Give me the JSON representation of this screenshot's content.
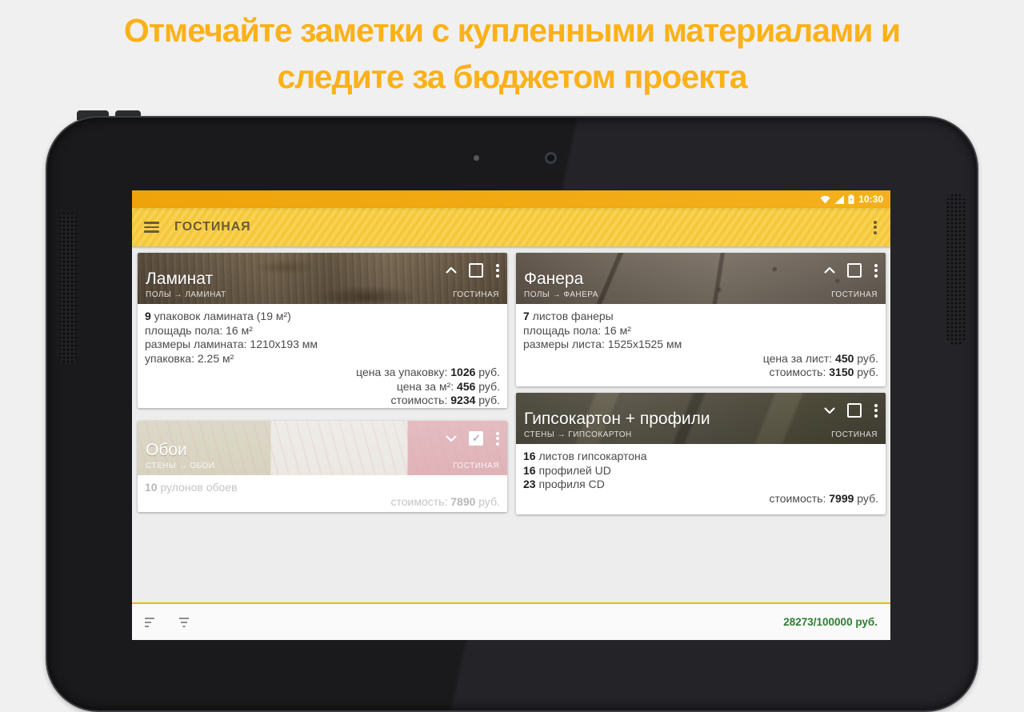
{
  "headline": {
    "line1": "Отмечайте заметки с купленными материалами и",
    "line2": "следите за бюджетом проекта"
  },
  "colors": {
    "headline_amber": "#FBB118",
    "status_bar_orange": "#F2A90F",
    "toolbar_yellow": "#F6CC45",
    "budget_green": "#2E7D32",
    "content_gray": "#EDEDED"
  },
  "status_bar": {
    "time": "10:30",
    "icons": [
      "wifi-icon",
      "cellular-signal-icon",
      "battery-icon"
    ]
  },
  "toolbar": {
    "title": "ГОСТИНАЯ",
    "menu_icon": "hamburger-menu-icon",
    "overflow_icon": "overflow-menu-icon"
  },
  "cards": [
    {
      "title": "Ламинат",
      "breadcrumb": "ПОЛЫ → ЛАМИНАТ",
      "room": "ГОСТИНАЯ",
      "chevron": "up",
      "checked": false,
      "left_lines": [
        {
          "pre": "",
          "b": "9",
          "post": " упаковок ламината (19 м²)"
        },
        {
          "pre": "площадь пола: 16 м²",
          "b": "",
          "post": ""
        },
        {
          "pre": "размеры ламината: 1210x193 мм",
          "b": "",
          "post": ""
        },
        {
          "pre": "упаковка: 2.25 м²",
          "b": "",
          "post": ""
        }
      ],
      "right_lines": [
        {
          "pre": "цена за упаковку: ",
          "b": "1026",
          "post": " руб."
        },
        {
          "pre": "цена за м²: ",
          "b": "456",
          "post": " руб."
        },
        {
          "pre": "стоимость: ",
          "b": "9234",
          "post": " руб."
        }
      ]
    },
    {
      "title": "Фанера",
      "breadcrumb": "ПОЛЫ → ФАНЕРА",
      "room": "ГОСТИНАЯ",
      "chevron": "up",
      "checked": false,
      "left_lines": [
        {
          "pre": "",
          "b": "7",
          "post": " листов фанеры"
        },
        {
          "pre": "площадь пола: 16 м²",
          "b": "",
          "post": ""
        },
        {
          "pre": "размеры листа: 1525x1525 мм",
          "b": "",
          "post": ""
        }
      ],
      "right_lines": [
        {
          "pre": "цена за лист: ",
          "b": "450",
          "post": " руб."
        },
        {
          "pre": "стоимость: ",
          "b": "3150",
          "post": " руб."
        }
      ]
    },
    {
      "title": "Обои",
      "breadcrumb": "СТЕНЫ → ОБОИ",
      "room": "ГОСТИНАЯ",
      "chevron": "down",
      "checked": true,
      "left_lines": [
        {
          "pre": "",
          "b": "10",
          "post": " рулонов обоев"
        }
      ],
      "right_lines": [
        {
          "pre": "стоимость: ",
          "b": "7890",
          "post": " руб."
        }
      ]
    },
    {
      "title": "Гипсокартон + профили",
      "breadcrumb": "СТЕНЫ → ГИПСОКАРТОН",
      "room": "ГОСТИНАЯ",
      "chevron": "down",
      "checked": false,
      "left_lines": [
        {
          "pre": "",
          "b": "16",
          "post": " листов гипсокартона"
        },
        {
          "pre": "",
          "b": "16",
          "post": " профилей UD"
        },
        {
          "pre": "",
          "b": "23",
          "post": " профиля CD"
        }
      ],
      "right_lines": [
        {
          "pre": "стоимость: ",
          "b": "7999",
          "post": " руб."
        }
      ]
    }
  ],
  "bottom_bar": {
    "total": "28273/100000 руб.",
    "icons": [
      "sort-icon",
      "filter-icon"
    ]
  }
}
